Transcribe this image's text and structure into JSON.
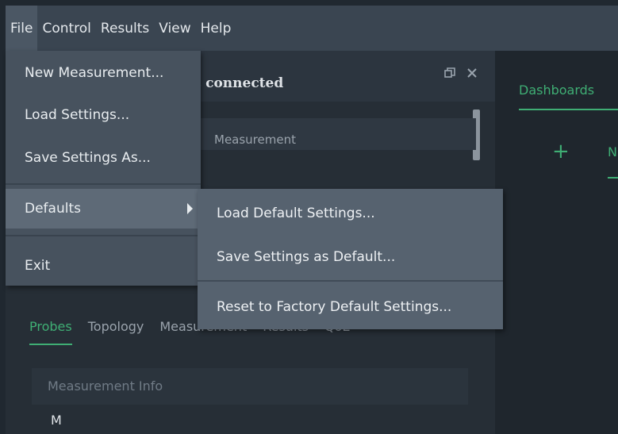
{
  "menubar": {
    "items": [
      "File",
      "Control",
      "Results",
      "View",
      "Help"
    ]
  },
  "left_panel": {
    "status_text": "ot connected",
    "strip_text": "Measurement",
    "tabs": [
      "Probes",
      "Topology",
      "Measurement",
      "Results",
      "QoE"
    ],
    "info_label": "Measurement Info",
    "bottom_char": "M"
  },
  "right_panel": {
    "dashboards_tab": "Dashboards",
    "plus": "+",
    "n_tab": "N"
  },
  "file_menu": {
    "items": [
      {
        "label": "New Measurement..."
      },
      {
        "label": "Load Settings..."
      },
      {
        "label": "Save Settings As..."
      },
      {
        "label": "Defaults"
      },
      {
        "label": "Exit"
      }
    ]
  },
  "defaults_submenu": {
    "items": [
      {
        "label": "Load Default Settings..."
      },
      {
        "label": "Save Settings as Default..."
      },
      {
        "label": "Reset to Factory Default Settings..."
      }
    ]
  },
  "icons": {
    "restore": "restore-window-icon",
    "close": "close-icon",
    "submenu_arrow": "chevron-right-icon"
  },
  "colors": {
    "accent": "#3fae74",
    "menubar": "#3a4551",
    "menu_bg": "#47525e",
    "submenu_bg": "#56626f"
  }
}
